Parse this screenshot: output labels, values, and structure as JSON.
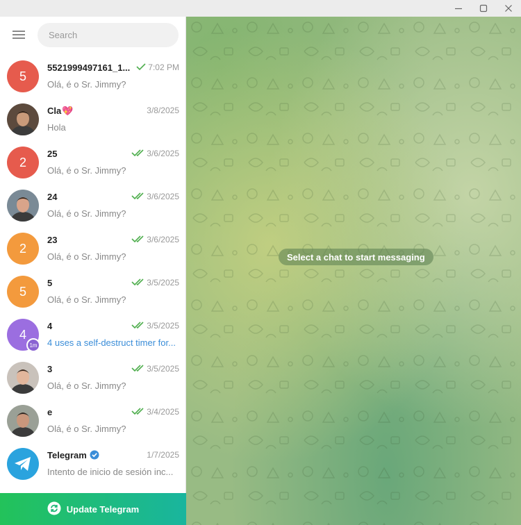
{
  "search": {
    "placeholder": "Search"
  },
  "chats": [
    {
      "name": "5521999497161_1...",
      "time": "7:02 PM",
      "status": "sent",
      "preview": "Olá, é o Sr. Jimmy?",
      "avatar": {
        "type": "initial",
        "initial": "5",
        "color": "#e65b4d"
      }
    },
    {
      "name": "Cla",
      "emoji": "💖",
      "time": "3/8/2025",
      "status": "none",
      "preview": "Hola",
      "avatar": {
        "type": "photo"
      }
    },
    {
      "name": "25",
      "time": "3/6/2025",
      "status": "read",
      "preview": "Olá, é o Sr. Jimmy?",
      "avatar": {
        "type": "initial",
        "initial": "2",
        "color": "#e65b4d"
      }
    },
    {
      "name": "24",
      "time": "3/6/2025",
      "status": "read",
      "preview": "Olá, é o Sr. Jimmy?",
      "avatar": {
        "type": "photo"
      }
    },
    {
      "name": "23",
      "time": "3/6/2025",
      "status": "read",
      "preview": "Olá, é o Sr. Jimmy?",
      "avatar": {
        "type": "initial",
        "initial": "2",
        "color": "#f39a3d"
      }
    },
    {
      "name": "5",
      "time": "3/5/2025",
      "status": "read",
      "preview": "Olá, é o Sr. Jimmy?",
      "avatar": {
        "type": "initial",
        "initial": "5",
        "color": "#f39a3d"
      }
    },
    {
      "name": "4",
      "time": "3/5/2025",
      "status": "read",
      "preview": "4 uses a self-destruct timer for...",
      "preview_highlight": true,
      "avatar": {
        "type": "initial",
        "initial": "4",
        "color": "#9b6ee0",
        "badge": "1m"
      }
    },
    {
      "name": "3",
      "time": "3/5/2025",
      "status": "read",
      "preview": "Olá, é o Sr. Jimmy?",
      "avatar": {
        "type": "photo"
      }
    },
    {
      "name": "e",
      "time": "3/4/2025",
      "status": "read",
      "preview": "Olá, é o Sr. Jimmy?",
      "avatar": {
        "type": "photo"
      }
    },
    {
      "name": "Telegram",
      "verified": true,
      "time": "1/7/2025",
      "status": "none",
      "preview": "Intento de inicio de sesión inc...",
      "avatar": {
        "type": "telegram"
      }
    }
  ],
  "update_button": {
    "label": "Update Telegram"
  },
  "main": {
    "empty_message": "Select a chat to start messaging"
  },
  "colors": {
    "accent_green": "#4fae4e",
    "read_check": "#4fae4e",
    "update_gradient_start": "#23c25a",
    "update_gradient_end": "#19b59e",
    "verified_blue": "#3a8dd8"
  }
}
